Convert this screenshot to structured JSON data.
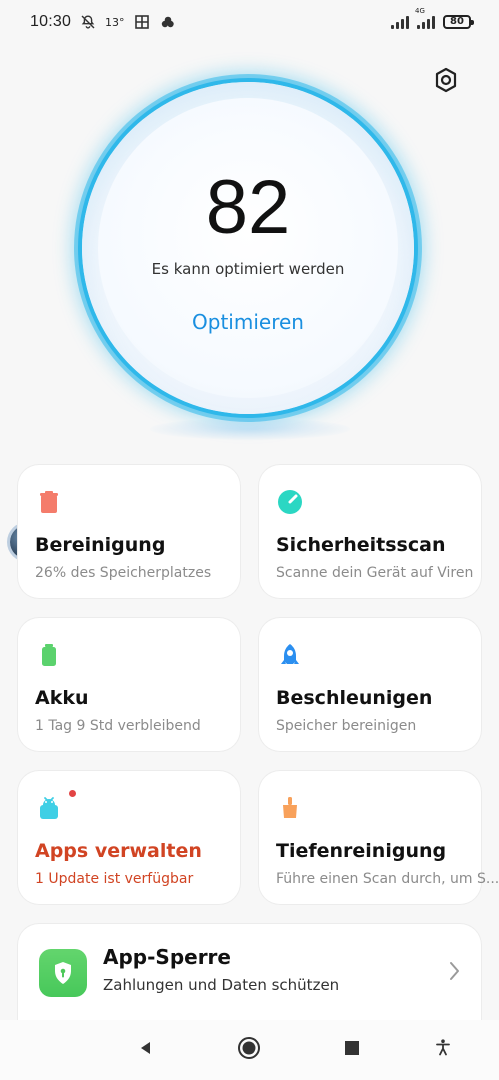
{
  "status_bar": {
    "time": "10:30",
    "temperature": "13°",
    "battery": "80",
    "network": "4G",
    "icons": [
      "bell-off-icon",
      "window-icon",
      "cloud-icon",
      "signal-icon",
      "signal-icon"
    ]
  },
  "hero": {
    "score": "82",
    "subtitle": "Es kann optimiert werden",
    "button_label": "Optimieren"
  },
  "cards": [
    {
      "title": "Bereinigung",
      "subtitle": "26% des Speicherplatzes",
      "icon": "trash-icon",
      "accent": "#f47c6b"
    },
    {
      "title": "Sicherheitsscan",
      "subtitle": "Scanne dein Gerät auf Viren",
      "icon": "shield-scan-icon",
      "accent": "#2bd7c3"
    },
    {
      "title": "Akku",
      "subtitle": "1 Tag 9 Std verbleibend",
      "icon": "battery-icon",
      "accent": "#5bd26d"
    },
    {
      "title": "Beschleunigen",
      "subtitle": "Speicher bereinigen",
      "icon": "rocket-icon",
      "accent": "#2b8ff0"
    },
    {
      "title": "Apps verwalten",
      "subtitle": "1 Update ist verfügbar",
      "icon": "android-icon",
      "accent": "#3fcfe5",
      "title_color": "#d14423",
      "subtitle_color": "#d14423"
    },
    {
      "title": "Tiefenreinigung",
      "subtitle": "Führe einen Scan durch, um S...",
      "icon": "brush-icon",
      "accent": "#f8a15b"
    }
  ],
  "wide_card": {
    "title": "App-Sperre",
    "subtitle": "Zahlungen und Daten schützen",
    "icon": "lock-shield-icon",
    "accent": "#4ec85a"
  },
  "bottom_nav": {
    "icons": [
      "back-icon",
      "home-icon",
      "recents-icon",
      "accessibility-icon"
    ]
  },
  "colors": {
    "primary_blue": "#1a8fe0",
    "alert_red": "#d14423",
    "card_background": "#ffffff",
    "page_background": "#f7f7f7"
  }
}
